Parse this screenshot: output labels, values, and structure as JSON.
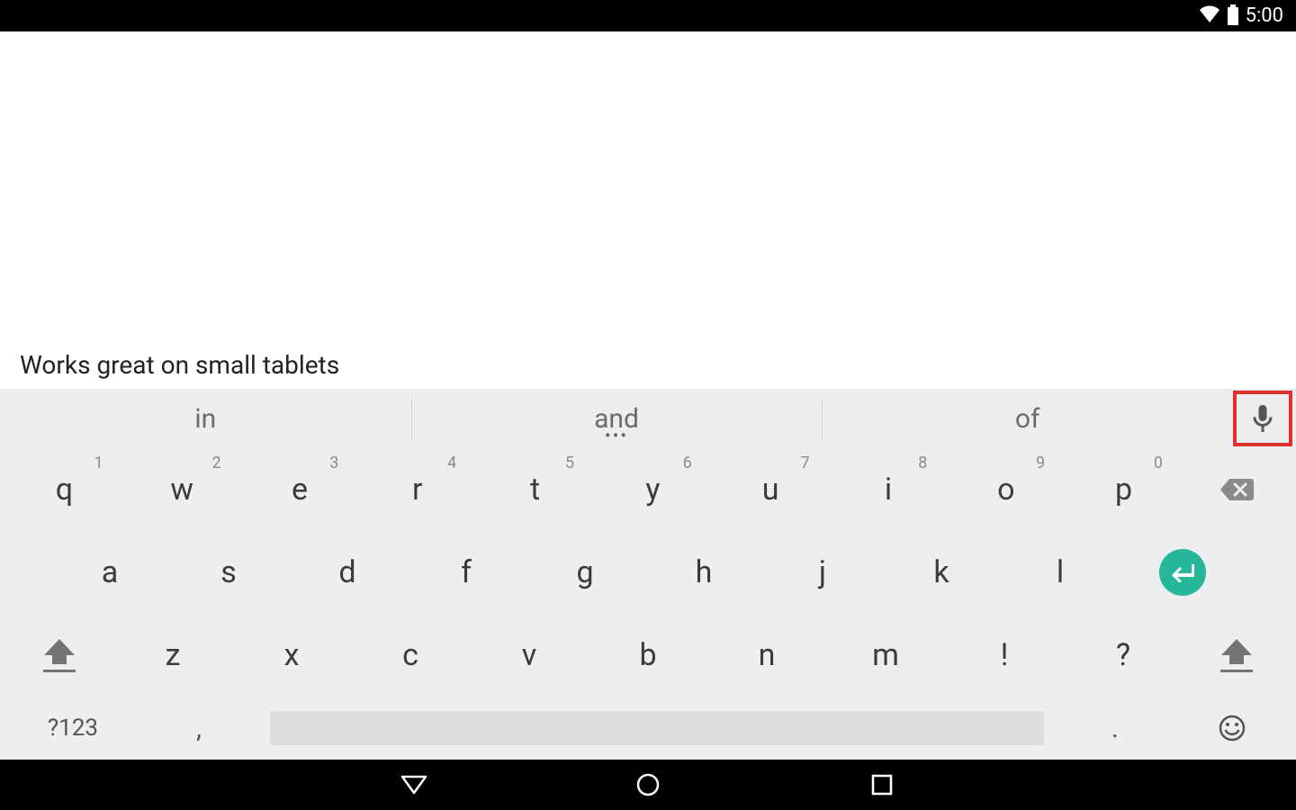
{
  "status": {
    "time": "5:00"
  },
  "content": {
    "typed_text": "Works great on small tablets"
  },
  "suggestions": {
    "s1": "in",
    "s2": "and",
    "s3": "of",
    "more": "•••"
  },
  "keyboard": {
    "row1": [
      {
        "k": "q",
        "n": "1"
      },
      {
        "k": "w",
        "n": "2"
      },
      {
        "k": "e",
        "n": "3"
      },
      {
        "k": "r",
        "n": "4"
      },
      {
        "k": "t",
        "n": "5"
      },
      {
        "k": "y",
        "n": "6"
      },
      {
        "k": "u",
        "n": "7"
      },
      {
        "k": "i",
        "n": "8"
      },
      {
        "k": "o",
        "n": "9"
      },
      {
        "k": "p",
        "n": "0"
      }
    ],
    "row2": [
      "a",
      "s",
      "d",
      "f",
      "g",
      "h",
      "j",
      "k",
      "l"
    ],
    "row3": [
      "z",
      "x",
      "c",
      "v",
      "b",
      "n",
      "m",
      "!",
      "?"
    ],
    "sym_label": "?123",
    "comma": ",",
    "period": "."
  }
}
